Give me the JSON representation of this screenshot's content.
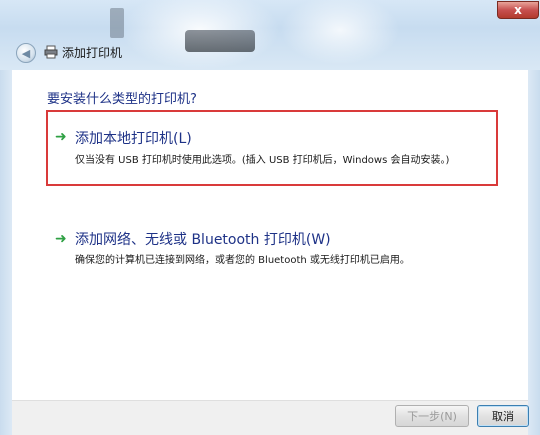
{
  "window": {
    "title": "添加打印机",
    "close_label": "x"
  },
  "main": {
    "question": "要安装什么类型的打印机?",
    "options": [
      {
        "title": "添加本地打印机(L)",
        "description": "仅当没有 USB 打印机时使用此选项。(插入 USB 打印机后，Windows 会自动安装。)"
      },
      {
        "title": "添加网络、无线或 Bluetooth 打印机(W)",
        "description": "确保您的计算机已连接到网络，或者您的 Bluetooth 或无线打印机已启用。"
      }
    ]
  },
  "footer": {
    "next_label": "下一步(N)",
    "cancel_label": "取消"
  },
  "colors": {
    "accent_text": "#1e3287",
    "highlight_border": "#d93a3a",
    "arrow": "#2ea043"
  },
  "icons": {
    "back": "back-arrow-icon",
    "printer": "printer-icon",
    "option_arrow": "green-arrow-icon",
    "close": "close-icon"
  }
}
